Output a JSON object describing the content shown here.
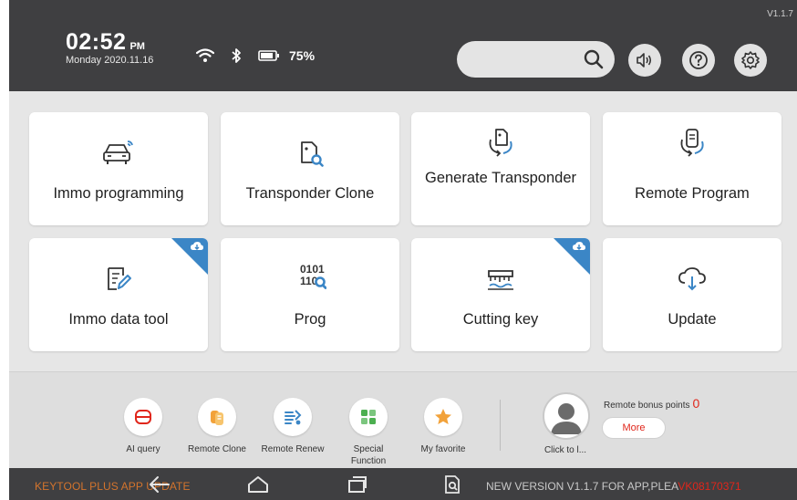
{
  "header": {
    "version": "V1.1.7",
    "time": "02:52",
    "ampm": "PM",
    "date": "Monday 2020.11.16",
    "battery": "75%"
  },
  "tiles": [
    {
      "label": "Immo programming",
      "icon": "car-signal-icon",
      "badge": false
    },
    {
      "label": "Transponder Clone",
      "icon": "chip-search-icon",
      "badge": false
    },
    {
      "label": "Generate Transponder",
      "icon": "key-fob-cycle-icon",
      "badge": false
    },
    {
      "label": "Remote Program",
      "icon": "remote-cycle-icon",
      "badge": false
    },
    {
      "label": "Immo data tool",
      "icon": "document-edit-icon",
      "badge": true
    },
    {
      "label": "Prog",
      "icon_text": "0101\n110",
      "icon": "binary-search-icon",
      "badge": false
    },
    {
      "label": "Cutting key",
      "icon": "key-cutting-icon",
      "badge": true
    },
    {
      "label": "Update",
      "icon": "cloud-download-icon",
      "badge": false
    }
  ],
  "shortcuts": [
    {
      "label": "AI query",
      "color": "#e0261b"
    },
    {
      "label": "Remote Clone",
      "color": "#f2a23a"
    },
    {
      "label": "Remote Renew",
      "color": "#3b86c6"
    },
    {
      "label": "Special Function",
      "color": "#4caf50"
    },
    {
      "label": "My favorite",
      "color": "#f2a23a"
    }
  ],
  "user": {
    "click_label": "Click to l...",
    "bonus_label": "Remote bonus points",
    "bonus_value": "0",
    "more_label": "More"
  },
  "navbar": {
    "left_text": "KEYTOOL PLUS APP UPDATE",
    "right_text": "NEW VERSION V1.1.7 FOR APP,PLEA",
    "serial": "VK08170371"
  },
  "colors": {
    "accent_blue": "#3b86c6",
    "alert_red": "#e0261b",
    "orange": "#d3742d"
  }
}
